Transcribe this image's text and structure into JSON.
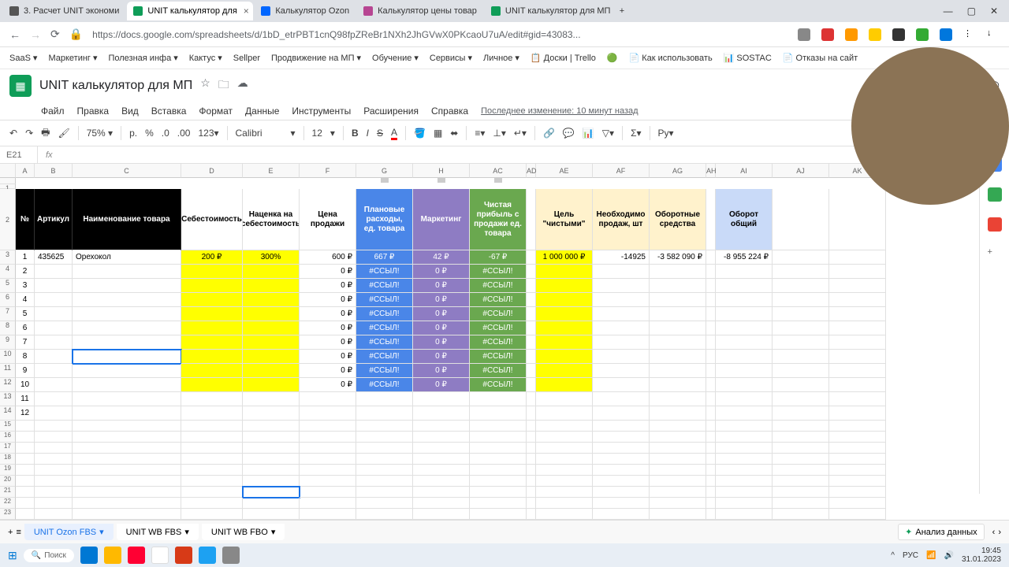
{
  "browser": {
    "tabs": [
      {
        "label": "3. Расчет UNIT экономи",
        "fav": "#555"
      },
      {
        "label": "UNIT калькулятор для",
        "fav": "#0f9d58",
        "active": true
      },
      {
        "label": "Калькулятор Ozon",
        "fav": "#0066ff"
      },
      {
        "label": "Калькулятор цены товар",
        "fav": "#b74592"
      },
      {
        "label": "UNIT калькулятор для МП",
        "fav": "#0f9d58"
      }
    ],
    "url": "https://docs.google.com/spreadsheets/d/1bD_etrPBT1cnQ98fpZReBr1NXh2JhGVwX0PKcaoU7uA/edit#gid=43083...",
    "bookmarks": [
      "SaaS",
      "Маркетинг",
      "Полезная инфа",
      "Кактус",
      "Sellper",
      "Продвижение на МП",
      "Обучение",
      "Сервисы",
      "Личное",
      "Доски | Trello",
      "Как использовать",
      "SOSTAC",
      "Отказы на сайт"
    ]
  },
  "doc": {
    "title": "UNIT калькулятор для МП",
    "menus": [
      "Файл",
      "Правка",
      "Вид",
      "Вставка",
      "Формат",
      "Данные",
      "Инструменты",
      "Расширения",
      "Справка"
    ],
    "lastEdit": "Последнее изменение: 10 минут назад",
    "zoom": "75%",
    "font": "Calibri",
    "size": "12",
    "cellRef": "E21",
    "fx": "fx"
  },
  "cols": [
    "",
    "A",
    "B",
    "C",
    "D",
    "E",
    "F",
    "G",
    "H",
    "AC",
    "AD",
    "AE",
    "AF",
    "AG",
    "AH",
    "AI",
    "AJ",
    "AK"
  ],
  "headers": {
    "num": "№",
    "art": "Артикул",
    "name": "Наименование товара",
    "cost": "Себестоимость",
    "markup": "Наценка на себестоимость",
    "price": "Цена продажи",
    "plan": "Плановые расходы, ед. товара",
    "mkt": "Маркетинг",
    "profit": "Чистая прибыль с продажи ед. товара",
    "goal": "Цель \"чистыми\"",
    "need": "Необходимо продаж, шт",
    "work": "Оборотные средства",
    "total": "Оборот общий"
  },
  "row1": {
    "n": "1",
    "art": "435625",
    "name": "Орехокол",
    "cost": "200 ₽",
    "markup": "300%",
    "price": "600 ₽",
    "plan": "667 ₽",
    "mkt": "42 ₽",
    "profit": "-67 ₽",
    "goal": "1 000 000 ₽",
    "need": "-14925",
    "work": "-3 582 090 ₽",
    "total": "-8 955 224 ₽"
  },
  "rows": [
    {
      "n": "2",
      "price": "0 ₽",
      "plan": "#ССЫЛ!",
      "mkt": "0 ₽",
      "profit": "#ССЫЛ!"
    },
    {
      "n": "3",
      "price": "0 ₽",
      "plan": "#ССЫЛ!",
      "mkt": "0 ₽",
      "profit": "#ССЫЛ!"
    },
    {
      "n": "4",
      "price": "0 ₽",
      "plan": "#ССЫЛ!",
      "mkt": "0 ₽",
      "profit": "#ССЫЛ!"
    },
    {
      "n": "5",
      "price": "0 ₽",
      "plan": "#ССЫЛ!",
      "mkt": "0 ₽",
      "profit": "#ССЫЛ!"
    },
    {
      "n": "6",
      "price": "0 ₽",
      "plan": "#ССЫЛ!",
      "mkt": "0 ₽",
      "profit": "#ССЫЛ!"
    },
    {
      "n": "7",
      "price": "0 ₽",
      "plan": "#ССЫЛ!",
      "mkt": "0 ₽",
      "profit": "#ССЫЛ!"
    },
    {
      "n": "8",
      "price": "0 ₽",
      "plan": "#ССЫЛ!",
      "mkt": "0 ₽",
      "profit": "#ССЫЛ!"
    },
    {
      "n": "9",
      "price": "0 ₽",
      "plan": "#ССЫЛ!",
      "mkt": "0 ₽",
      "profit": "#ССЫЛ!"
    },
    {
      "n": "10",
      "price": "0 ₽",
      "plan": "#ССЫЛ!",
      "mkt": "0 ₽",
      "profit": "#ССЫЛ!"
    }
  ],
  "extra": [
    "11",
    "12"
  ],
  "sheets": {
    "plus": "+",
    "list": "≡",
    "tabs": [
      "UNIT Ozon FBS",
      "UNIT WB FBS",
      "UNIT WB FBO"
    ],
    "analiz": "Анализ данных"
  },
  "taskbar": {
    "search": "Поиск",
    "lang": "РУС",
    "time": "19:45",
    "date": "31.01.2023"
  }
}
